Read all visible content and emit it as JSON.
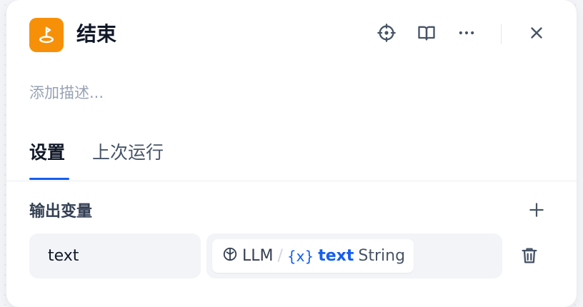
{
  "node": {
    "title": "结束",
    "icon": "end-node-icon",
    "icon_color": "#f79009",
    "description_placeholder": "添加描述..."
  },
  "header_actions": [
    "crosshair-icon",
    "book-icon",
    "more-icon",
    "close-icon"
  ],
  "tabs": [
    {
      "label": "设置",
      "active": true
    },
    {
      "label": "上次运行",
      "active": false
    }
  ],
  "output": {
    "section_title": "输出变量",
    "variables": [
      {
        "name": "text",
        "ref_node": "LLM",
        "ref_separator": "/",
        "ref_var_prefix": "{x}",
        "ref_var": "text",
        "ref_type": "String"
      }
    ]
  },
  "colors": {
    "accent": "#155eef",
    "node_icon_bg": "#f79009"
  }
}
